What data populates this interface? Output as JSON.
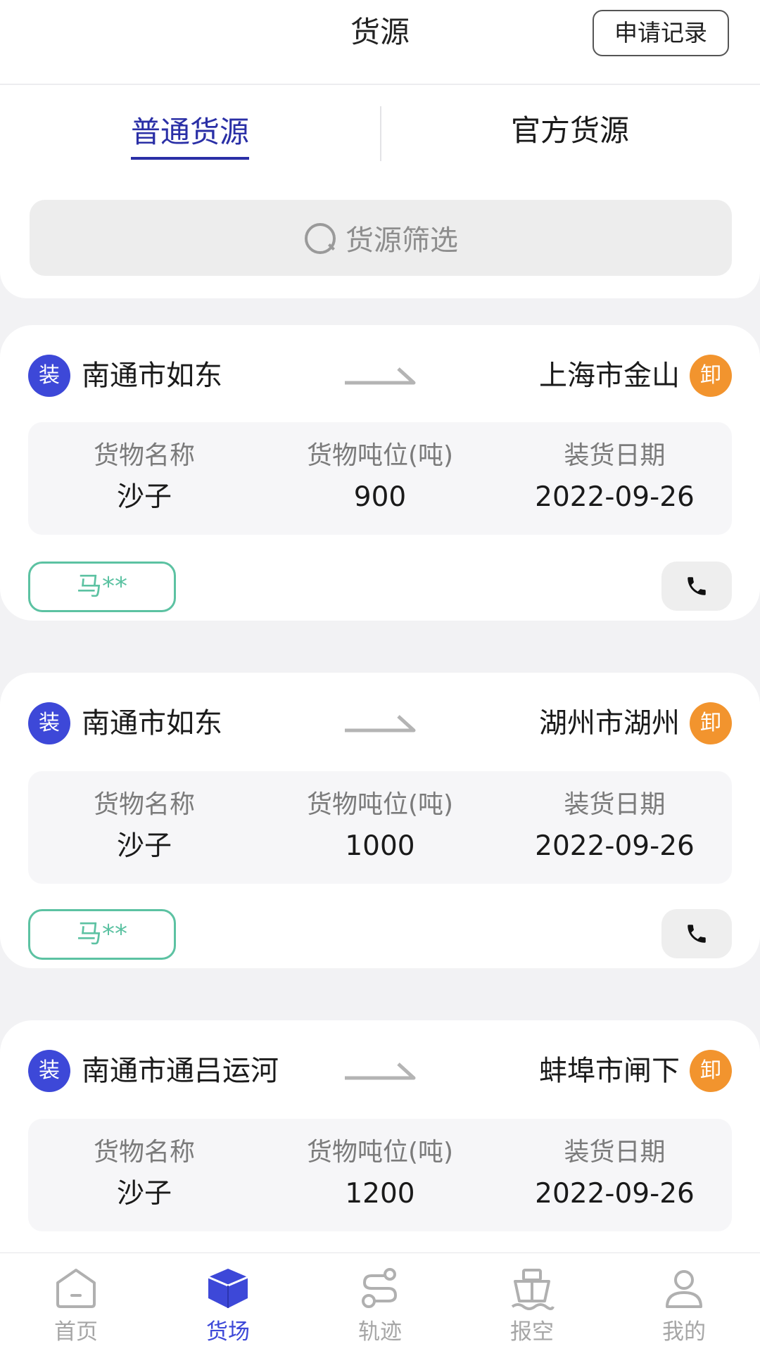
{
  "header": {
    "title": "货源",
    "record_button": "申请记录"
  },
  "tabs": [
    {
      "label": "普通货源",
      "active": true
    },
    {
      "label": "官方货源",
      "active": false
    }
  ],
  "search": {
    "placeholder": "货源筛选"
  },
  "card_labels": {
    "load_tag": "装",
    "unload_tag": "卸",
    "cargo_name": "货物名称",
    "cargo_tonnage": "货物吨位(吨)",
    "load_date": "装货日期"
  },
  "cards": [
    {
      "origin": "南通市如东",
      "destination": "上海市金山",
      "cargo_name": "沙子",
      "tonnage": "900",
      "load_date": "2022-09-26",
      "contact": "马**"
    },
    {
      "origin": "南通市如东",
      "destination": "湖州市湖州",
      "cargo_name": "沙子",
      "tonnage": "1000",
      "load_date": "2022-09-26",
      "contact": "马**"
    },
    {
      "origin": "南通市通吕运河",
      "destination": "蚌埠市闸下",
      "cargo_name": "沙子",
      "tonnage": "1200",
      "load_date": "2022-09-26"
    }
  ],
  "bottom_nav": [
    {
      "label": "首页",
      "icon": "home-icon",
      "active": false
    },
    {
      "label": "货场",
      "icon": "cargo-box-icon",
      "active": true
    },
    {
      "label": "轨迹",
      "icon": "route-icon",
      "active": false
    },
    {
      "label": "报空",
      "icon": "ship-icon",
      "active": false
    },
    {
      "label": "我的",
      "icon": "user-icon",
      "active": false
    }
  ],
  "colors": {
    "primary": "#2a2fa6",
    "load_tag": "#3d48d8",
    "unload_tag": "#f2942e",
    "contact": "#5cc2a2",
    "muted": "#a6a6a6"
  }
}
